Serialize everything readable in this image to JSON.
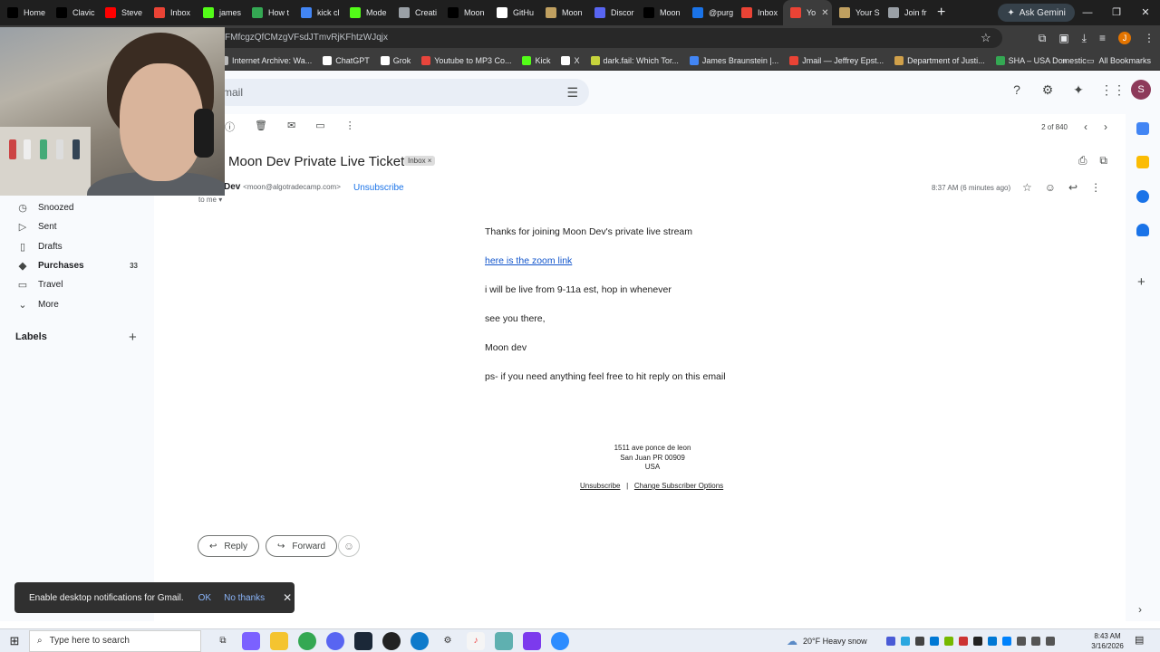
{
  "browser": {
    "tabs": [
      {
        "label": "Home",
        "icon": "x-icon",
        "color": "#000000"
      },
      {
        "label": "Clavic",
        "icon": "x-icon",
        "color": "#000000"
      },
      {
        "label": "Steve",
        "icon": "youtube-icon",
        "color": "#ff0000"
      },
      {
        "label": "Inbox",
        "icon": "gmail-icon",
        "color": "#ea4335"
      },
      {
        "label": "james",
        "icon": "kick-icon",
        "color": "#53fc18"
      },
      {
        "label": "How t",
        "icon": "globe-icon",
        "color": "#34a853"
      },
      {
        "label": "kick cl",
        "icon": "google-icon",
        "color": "#4285f4"
      },
      {
        "label": "Mode",
        "icon": "kick-icon",
        "color": "#53fc18"
      },
      {
        "label": "Creati",
        "icon": "loader-icon",
        "color": "#9aa0a6"
      },
      {
        "label": "Moon",
        "icon": "x-icon",
        "color": "#000000"
      },
      {
        "label": "GitHu",
        "icon": "github-icon",
        "color": "#ffffff"
      },
      {
        "label": "Moon",
        "icon": "image-icon",
        "color": "#c0a060"
      },
      {
        "label": "Discor",
        "icon": "discord-icon",
        "color": "#5865f2"
      },
      {
        "label": "Moon",
        "icon": "x-icon",
        "color": "#000000"
      },
      {
        "label": "@purg",
        "icon": "id-icon",
        "color": "#1a73e8"
      },
      {
        "label": "Inbox",
        "icon": "gmail-icon",
        "color": "#ea4335"
      },
      {
        "label": "Yo",
        "icon": "gmail-icon",
        "color": "#ea4335",
        "active": true
      },
      {
        "label": "Your S",
        "icon": "image-icon",
        "color": "#c0a060"
      },
      {
        "label": "Join fr",
        "icon": "globe-icon",
        "color": "#9aa0a6"
      }
    ],
    "ask_gemini": "Ask Gemini",
    "url": "FMfcgzQfCMzgVFsdJTmvRjKFhtzWJqjx",
    "profile_initial": "J",
    "bookmarks": [
      {
        "label": "Internet Archive: Wa...",
        "color": "#bbbbbb"
      },
      {
        "label": "ChatGPT",
        "color": "#ffffff"
      },
      {
        "label": "Grok",
        "color": "#ffffff"
      },
      {
        "label": "Youtube to MP3 Co...",
        "color": "#e8453c"
      },
      {
        "label": "Kick",
        "color": "#53fc18"
      },
      {
        "label": "X",
        "color": "#ffffff"
      },
      {
        "label": "dark.fail: Which Tor...",
        "color": "#c6d33c"
      },
      {
        "label": "James Braunstein |...",
        "color": "#4285f4"
      },
      {
        "label": "Jmail — Jeffrey Epst...",
        "color": "#ea4335"
      },
      {
        "label": "Department of Justi...",
        "color": "#d0a04a"
      },
      {
        "label": "SHA – USA Domestic",
        "color": "#34a853"
      }
    ],
    "all_bookmarks": "All Bookmarks"
  },
  "gmail": {
    "search_placeholder": "mail",
    "avatar_initial": "S",
    "nav": [
      {
        "label": "Snoozed",
        "icon": "clock-icon"
      },
      {
        "label": "Sent",
        "icon": "send-icon"
      },
      {
        "label": "Drafts",
        "icon": "draft-icon"
      },
      {
        "label": "Purchases",
        "icon": "tag-icon",
        "count": "33",
        "bold": true
      },
      {
        "label": "Travel",
        "icon": "suitcase-icon"
      },
      {
        "label": "More",
        "icon": "chevron-down-icon"
      }
    ],
    "labels_heading": "Labels",
    "pager": "2 of 840",
    "subject": "Moon Dev Private Live Ticket",
    "inbox_chip": "Inbox ×",
    "sender_name": "Dev",
    "sender_email": "<moon@algotradecamp.com>",
    "unsubscribe": "Unsubscribe",
    "to_me": "to me ▾",
    "timestamp": "8:37 AM (6 minutes ago)",
    "body": {
      "line1": "Thanks for joining Moon Dev's private live stream",
      "link": "here is the zoom link",
      "line3": "i will be live from 9-11a est, hop in whenever",
      "line4": "see you there,",
      "line5": "Moon dev",
      "line6": "ps- if you need anything feel free to hit reply on this email"
    },
    "footer": {
      "addr1": "1511 ave  ponce de leon",
      "addr2": "San Juan PR 00909",
      "addr3": "USA",
      "unsub": "Unsubscribe",
      "sep": "|",
      "change": "Change Subscriber Options"
    },
    "reply_label": "Reply",
    "forward_label": "Forward",
    "toast": {
      "text": "Enable desktop notifications for Gmail.",
      "ok": "OK",
      "no_thanks": "No thanks"
    }
  },
  "taskbar": {
    "search_placeholder": "Type here to search",
    "weather": "20°F  Heavy snow",
    "time": "8:43 AM",
    "date": "3/16/2026"
  }
}
